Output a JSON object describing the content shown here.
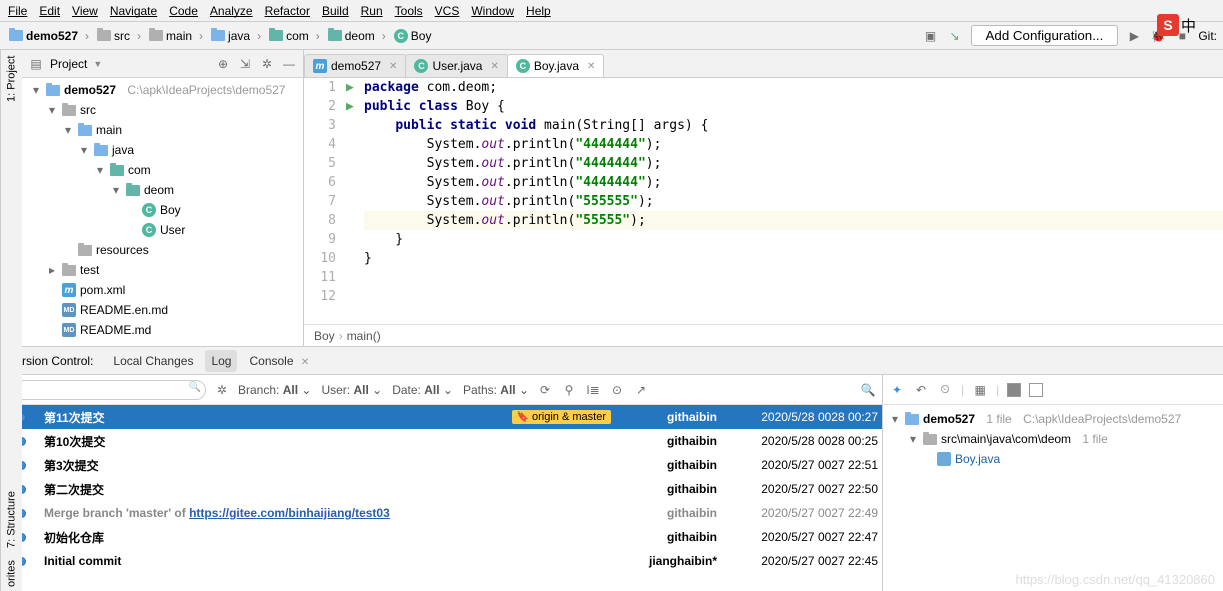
{
  "menu": [
    "File",
    "Edit",
    "View",
    "Navigate",
    "Code",
    "Analyze",
    "Refactor",
    "Build",
    "Run",
    "Tools",
    "VCS",
    "Window",
    "Help"
  ],
  "breadcrumbs": [
    {
      "label": "demo527",
      "icon": "folder-blue"
    },
    {
      "label": "src",
      "icon": "folder"
    },
    {
      "label": "main",
      "icon": "folder"
    },
    {
      "label": "java",
      "icon": "folder-blue"
    },
    {
      "label": "com",
      "icon": "folder-cyan"
    },
    {
      "label": "deom",
      "icon": "folder-cyan"
    },
    {
      "label": "Boy",
      "icon": "class"
    }
  ],
  "run_config": "Add Configuration...",
  "git_label": "Git:",
  "project": {
    "title": "Project",
    "tree": [
      {
        "depth": 0,
        "arrow": "▾",
        "icon": "folder-blue",
        "label": "demo527",
        "suffix": "C:\\apk\\IdeaProjects\\demo527",
        "bold": true
      },
      {
        "depth": 1,
        "arrow": "▾",
        "icon": "folder",
        "label": "src"
      },
      {
        "depth": 2,
        "arrow": "▾",
        "icon": "folder-blue",
        "label": "main"
      },
      {
        "depth": 3,
        "arrow": "▾",
        "icon": "folder-blue",
        "label": "java"
      },
      {
        "depth": 4,
        "arrow": "▾",
        "icon": "folder-cyan",
        "label": "com"
      },
      {
        "depth": 5,
        "arrow": "▾",
        "icon": "folder-cyan",
        "label": "deom"
      },
      {
        "depth": 6,
        "arrow": "",
        "icon": "class",
        "label": "Boy"
      },
      {
        "depth": 6,
        "arrow": "",
        "icon": "class",
        "label": "User"
      },
      {
        "depth": 2,
        "arrow": "",
        "icon": "folder",
        "label": "resources"
      },
      {
        "depth": 1,
        "arrow": "▸",
        "icon": "folder",
        "label": "test"
      },
      {
        "depth": 1,
        "arrow": "",
        "icon": "m",
        "label": "pom.xml"
      },
      {
        "depth": 1,
        "arrow": "",
        "icon": "md",
        "label": "README.en.md"
      },
      {
        "depth": 1,
        "arrow": "",
        "icon": "md",
        "label": "README.md"
      }
    ]
  },
  "tabs": [
    {
      "icon": "m",
      "label": "demo527",
      "active": false
    },
    {
      "icon": "class",
      "label": "User.java",
      "active": false
    },
    {
      "icon": "class",
      "label": "Boy.java",
      "active": true
    }
  ],
  "code": {
    "pkg": "package",
    "cls": "class",
    "pub": "public",
    "stat": "static",
    "vd": "void",
    "pkgName": "com.deom",
    "clsName": "Boy",
    "main": "main",
    "args": "(String[] args)",
    "sys": "System",
    "out": "out",
    "pl": "println",
    "s1": "\"4444444\"",
    "s2": "\"4444444\"",
    "s3": "\"4444444\"",
    "s4": "\"555555\"",
    "s5": "\"55555\"",
    "lines": [
      1,
      2,
      3,
      4,
      5,
      6,
      7,
      8,
      9,
      10,
      11,
      12
    ],
    "run_markers": [
      3,
      4
    ],
    "highlighted": 9
  },
  "crumb": {
    "a": "Boy",
    "b": "main()"
  },
  "vc": {
    "title": "Version Control:",
    "tabs": [
      "Local Changes",
      "Log",
      "Console"
    ],
    "active_tab": "Log",
    "filters": [
      {
        "k": "Branch:",
        "v": "All"
      },
      {
        "k": "User:",
        "v": "All"
      },
      {
        "k": "Date:",
        "v": "All"
      },
      {
        "k": "Paths:",
        "v": "All"
      }
    ],
    "commits": [
      {
        "msg": "第11次提交",
        "tag": "origin & master",
        "author": "githaibin",
        "date": "2020/5/28 0028 00:27",
        "sel": true
      },
      {
        "msg": "第10次提交",
        "author": "githaibin",
        "date": "2020/5/28 0028 00:25"
      },
      {
        "msg": "第3次提交",
        "author": "githaibin",
        "date": "2020/5/27 0027 22:51"
      },
      {
        "msg": "第二次提交",
        "author": "githaibin",
        "date": "2020/5/27 0027 22:50"
      },
      {
        "msg_pre": "Merge branch 'master' of ",
        "link": "https://gitee.com/binhaijiang/test03",
        "author": "githaibin",
        "date": "2020/5/27 0027 22:49",
        "merge": true
      },
      {
        "msg": "初始化仓库",
        "author": "githaibin",
        "date": "2020/5/27 0027 22:47"
      },
      {
        "msg": "Initial commit",
        "author": "jianghaibin*",
        "date": "2020/5/27 0027 22:45"
      }
    ],
    "right": {
      "root": "demo527",
      "root_suffix": "1 file",
      "root_path": "C:\\apk\\IdeaProjects\\demo527",
      "path": "src\\main\\java\\com\\deom",
      "path_suffix": "1 file",
      "file": "Boy.java"
    }
  },
  "side_labels": {
    "proj": "1: Project",
    "struct": "7: Structure",
    "fav": "orites"
  },
  "watermark": "https://blog.csdn.net/qq_41320860",
  "sogou": {
    "s": "S",
    "z": "中"
  }
}
